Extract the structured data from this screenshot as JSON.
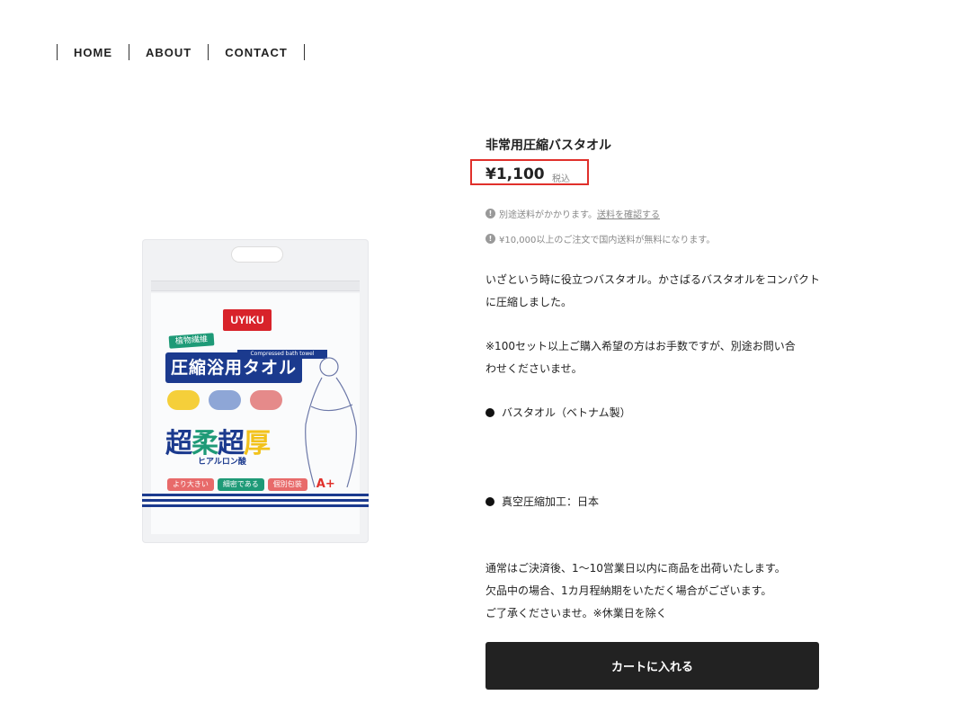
{
  "nav": {
    "items": [
      "HOME",
      "ABOUT",
      "CONTACT"
    ]
  },
  "product": {
    "image_alt_brand": "UYIKU",
    "title": "非常用圧縮バスタオル",
    "price": "¥1,100",
    "tax_label": "税込",
    "notes": {
      "shipping_prefix": "別途送料がかかります。",
      "shipping_link": "送料を確認する",
      "free_shipping": "¥10,000以上のご注文で国内送料が無料になります。"
    },
    "description": [
      "いざという時に役立つバスタオル。かさばるバスタオルをコンパクト",
      "に圧縮しました。",
      "※100セット以上ご購入希望の方はお手数ですが、別途お問い合",
      "わせくださいませ。"
    ],
    "spec1": "バスタオル（ベトナム製）",
    "spec2": "真空圧縮加工：日本",
    "shipping_info": [
      "通常はご決済後、1〜10営業日以内に商品を出荷いたします。",
      "欠品中の場合、1カ月程納期をいただく場合がございます。",
      "ご了承くださいませ。※休業日を除く"
    ],
    "cart_button": "カートに入れる"
  },
  "package_art": {
    "brand": "UYIKU",
    "green_tag": "植物繊維",
    "english": "Compressed bath towel",
    "banner": "圧縮浴用タオル",
    "big_text": [
      "超",
      "柔",
      "超",
      "厚"
    ],
    "sub": "ヒアルロン酸",
    "pills": [
      "より大きい",
      "細密である",
      "個別包装"
    ],
    "grade": "A+"
  },
  "colors": {
    "price_highlight": "#e0302b",
    "button_bg": "#222222",
    "package_navy": "#1b3a8e"
  }
}
